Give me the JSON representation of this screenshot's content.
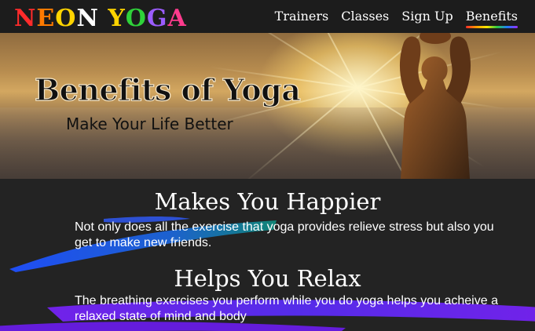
{
  "nav": {
    "logo": "NEON YOGA",
    "logo_colors": [
      "#ff2b2b",
      "#ff7a00",
      "#ffd400",
      "#ffffff",
      "#ffd400",
      "#2fd13a",
      "#9b5cff",
      "#ff3b8d",
      "#ff6a00"
    ],
    "links": [
      {
        "label": "Trainers"
      },
      {
        "label": "Classes"
      },
      {
        "label": "Sign Up"
      },
      {
        "label": "Benefits",
        "active": true
      }
    ]
  },
  "hero": {
    "title": "Benefits of Yoga",
    "subtitle": "Make Your Life Better"
  },
  "sections": [
    {
      "heading": "Makes You Happier",
      "text": "Not only does all the exercise that yoga provides relieve stress but also you get to make new friends."
    },
    {
      "heading": "Helps You Relax",
      "text": "The breathing exercises you perform while you do yoga helps you acheive a relaxed state of mind and body"
    }
  ],
  "colors": {
    "background": "#232323",
    "nav_background": "#1c1c1c",
    "brush_blue": "#1f4fff",
    "brush_purple": "#7a22ff"
  }
}
